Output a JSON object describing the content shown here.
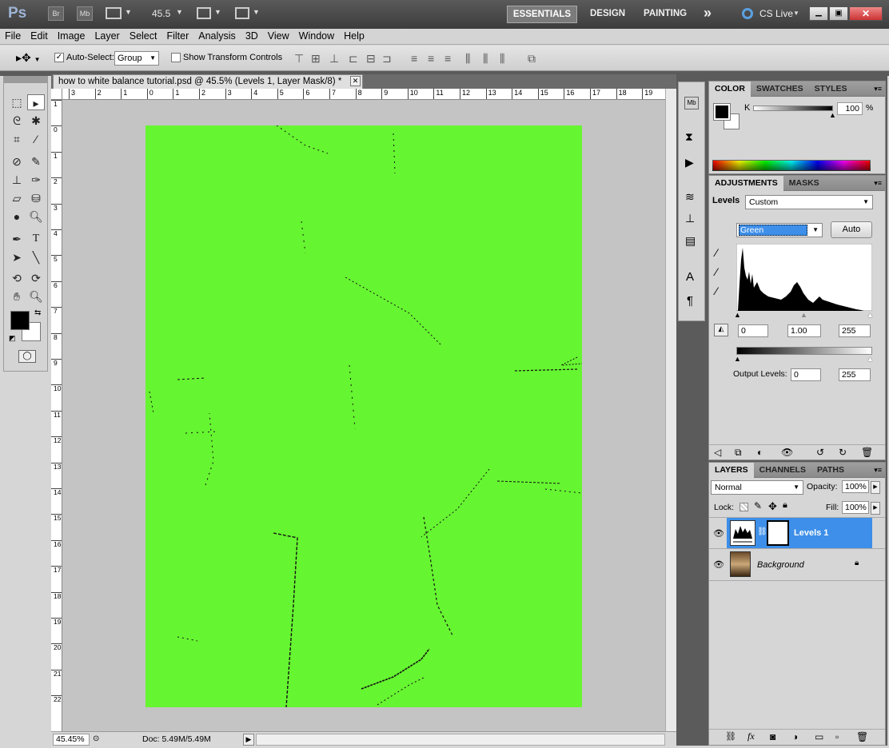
{
  "app": {
    "logo": "Ps",
    "zoom_field": "45.5",
    "workspaces": [
      "ESSENTIALS",
      "DESIGN",
      "PAINTING"
    ],
    "more": "»",
    "cs_live": "CS Live",
    "bridge": "Br",
    "minibridge": "Mb"
  },
  "menu": [
    "File",
    "Edit",
    "Image",
    "Layer",
    "Select",
    "Filter",
    "Analysis",
    "3D",
    "View",
    "Window",
    "Help"
  ],
  "options": {
    "auto_select_label": "Auto-Select:",
    "auto_select_value": "Group",
    "transform_label": "Show Transform Controls"
  },
  "document": {
    "tab_title": "how to white balance tutorial.psd @ 45.5% (Levels 1, Layer Mask/8) *",
    "canvas_color": "#66f531",
    "ruler_top": [
      "3",
      "2",
      "1",
      "0",
      "1",
      "2",
      "3",
      "4",
      "5",
      "6",
      "7",
      "8",
      "9",
      "10",
      "11",
      "12",
      "13",
      "14",
      "15",
      "16",
      "17",
      "18",
      "19"
    ],
    "ruler_left": [
      "1",
      "0",
      "1",
      "2",
      "3",
      "4",
      "5",
      "6",
      "7",
      "8",
      "9",
      "10",
      "11",
      "12",
      "13",
      "14",
      "15",
      "16",
      "17",
      "18",
      "19",
      "20",
      "21",
      "22"
    ]
  },
  "status": {
    "zoom": "45.45%",
    "doc": "Doc: 5.49M/5.49M"
  },
  "color_panel": {
    "tabs": [
      "COLOR",
      "SWATCHES",
      "STYLES"
    ],
    "channel": "K",
    "value": "100",
    "unit": "%"
  },
  "adjustments": {
    "tabs": [
      "ADJUSTMENTS",
      "MASKS"
    ],
    "title": "Levels",
    "preset": "Custom",
    "channel": "Green",
    "auto": "Auto",
    "input_black": "0",
    "input_gamma": "1.00",
    "input_white": "255",
    "output_label": "Output Levels:",
    "output_black": "0",
    "output_white": "255"
  },
  "layers_panel": {
    "tabs": [
      "LAYERS",
      "CHANNELS",
      "PATHS"
    ],
    "blend": "Normal",
    "opacity_label": "Opacity:",
    "opacity": "100%",
    "lock_label": "Lock:",
    "fill_label": "Fill:",
    "fill": "100%",
    "layers": [
      {
        "name": "Levels 1",
        "selected": true
      },
      {
        "name": "Background",
        "selected": false
      }
    ]
  }
}
